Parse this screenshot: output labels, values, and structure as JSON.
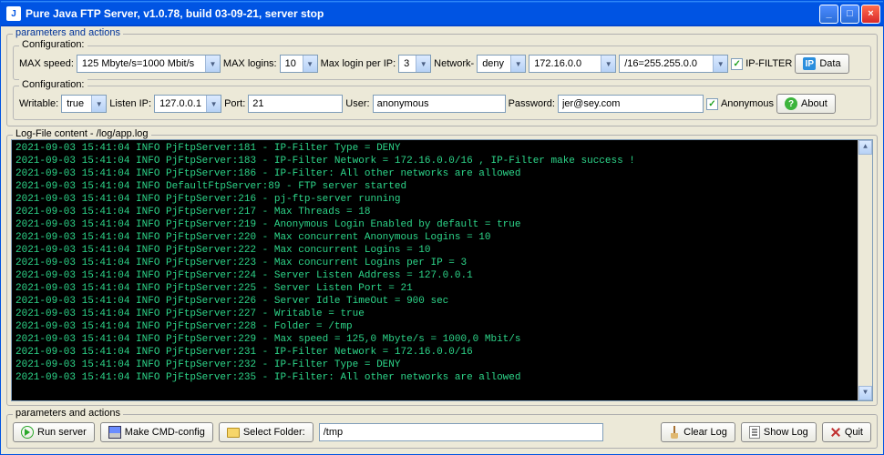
{
  "window": {
    "title": "Pure Java FTP Server, v1.0.78, build 03-09-21, server stop"
  },
  "top_group_legend": "parameters and actions",
  "config1": {
    "legend": "Configuration:",
    "max_speed_label": "MAX speed:",
    "max_speed_value": "125 Mbyte/s=1000 Mbit/s",
    "max_logins_label": "MAX logins:",
    "max_logins_value": "10",
    "max_login_per_ip_label": "Max login per IP:",
    "max_login_per_ip_value": "3",
    "network_label": "Network-",
    "network_mode": "deny",
    "network_ip": "172.16.0.0",
    "network_mask": "/16=255.255.0.0",
    "ip_filter_label": "IP-FILTER",
    "data_btn": "Data"
  },
  "config2": {
    "legend": "Configuration:",
    "writable_label": "Writable:",
    "writable_value": "true",
    "listen_ip_label": "Listen IP:",
    "listen_ip_value": "127.0.0.1",
    "port_label": "Port:",
    "port_value": "21",
    "user_label": "User:",
    "user_value": "anonymous",
    "password_label": "Password:",
    "password_value": "jer@sey.com",
    "anonymous_label": "Anonymous",
    "about_btn": "About"
  },
  "log": {
    "legend": "Log-File content - /log/app.log",
    "lines": [
      "2021-09-03 15:41:04 INFO  PjFtpServer:181 - IP-Filter Type = DENY",
      "2021-09-03 15:41:04 INFO  PjFtpServer:183 - IP-Filter Network = 172.16.0.0/16 , IP-Filter make success !",
      "2021-09-03 15:41:04 INFO  PjFtpServer:186 - IP-Filter:  All other networks are allowed",
      "2021-09-03 15:41:04 INFO  DefaultFtpServer:89 - FTP server started",
      "2021-09-03 15:41:04 INFO  PjFtpServer:216 - pj-ftp-server running",
      "2021-09-03 15:41:04 INFO  PjFtpServer:217 - Max Threads = 18",
      "2021-09-03 15:41:04 INFO  PjFtpServer:219 - Anonymous Login Enabled by default = true",
      "2021-09-03 15:41:04 INFO  PjFtpServer:220 - Max concurrent Anonymous Logins = 10",
      "2021-09-03 15:41:04 INFO  PjFtpServer:222 - Max concurrent Logins = 10",
      "2021-09-03 15:41:04 INFO  PjFtpServer:223 - Max concurrent Logins per IP = 3",
      "2021-09-03 15:41:04 INFO  PjFtpServer:224 - Server Listen Address = 127.0.0.1",
      "2021-09-03 15:41:04 INFO  PjFtpServer:225 - Server Listen Port = 21",
      "2021-09-03 15:41:04 INFO  PjFtpServer:226 - Server Idle TimeOut = 900 sec",
      "2021-09-03 15:41:04 INFO  PjFtpServer:227 - Writable = true",
      "2021-09-03 15:41:04 INFO  PjFtpServer:228 - Folder = /tmp",
      "2021-09-03 15:41:04 INFO  PjFtpServer:229 - Max speed = 125,0 Mbyte/s = 1000,0 Mbit/s",
      "2021-09-03 15:41:04 INFO  PjFtpServer:231 - IP-Filter Network = 172.16.0.0/16",
      "2021-09-03 15:41:04 INFO  PjFtpServer:232 - IP-Filter Type = DENY",
      "2021-09-03 15:41:04 INFO  PjFtpServer:235 - IP-Filter:  All other networks are allowed"
    ]
  },
  "bottom": {
    "legend": "parameters and actions",
    "run_btn": "Run server",
    "make_cmd_btn": "Make CMD-config",
    "select_folder_btn": "Select Folder:",
    "folder_value": "/tmp",
    "clear_log_btn": "Clear Log",
    "show_log_btn": "Show Log",
    "quit_btn": "Quit"
  }
}
